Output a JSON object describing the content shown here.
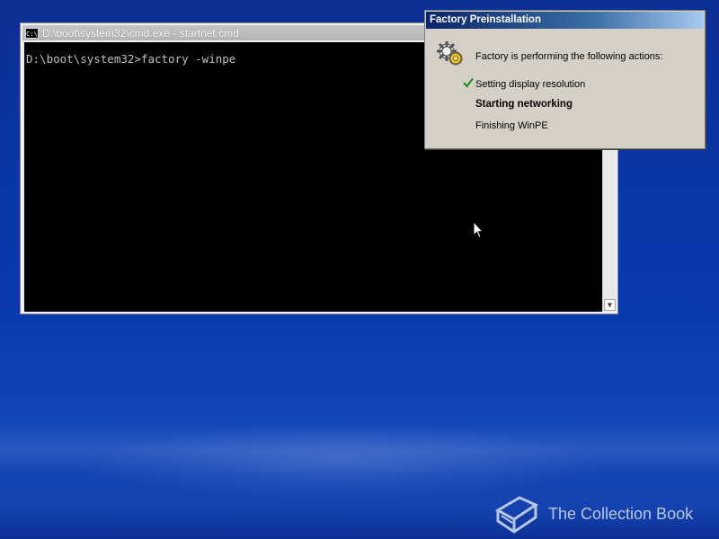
{
  "cmd": {
    "title": "D:\\boot\\system32\\cmd.exe - startnet.cmd",
    "icon_label": "C:\\",
    "line1": "D:\\boot\\system32>factory -winpe"
  },
  "dialog": {
    "title": "Factory Preinstallation",
    "header": "Factory is performing the following actions:",
    "steps": [
      {
        "label": "Setting display resolution",
        "state": "done"
      },
      {
        "label": "Starting networking",
        "state": "active"
      },
      {
        "label": "Finishing WinPE",
        "state": "pending"
      }
    ]
  },
  "watermark": {
    "text": "The Collection Book"
  },
  "colors": {
    "desktop": "#0b3aae",
    "check": "#1a8a1a",
    "dialog_bg": "#d4d0c8"
  }
}
